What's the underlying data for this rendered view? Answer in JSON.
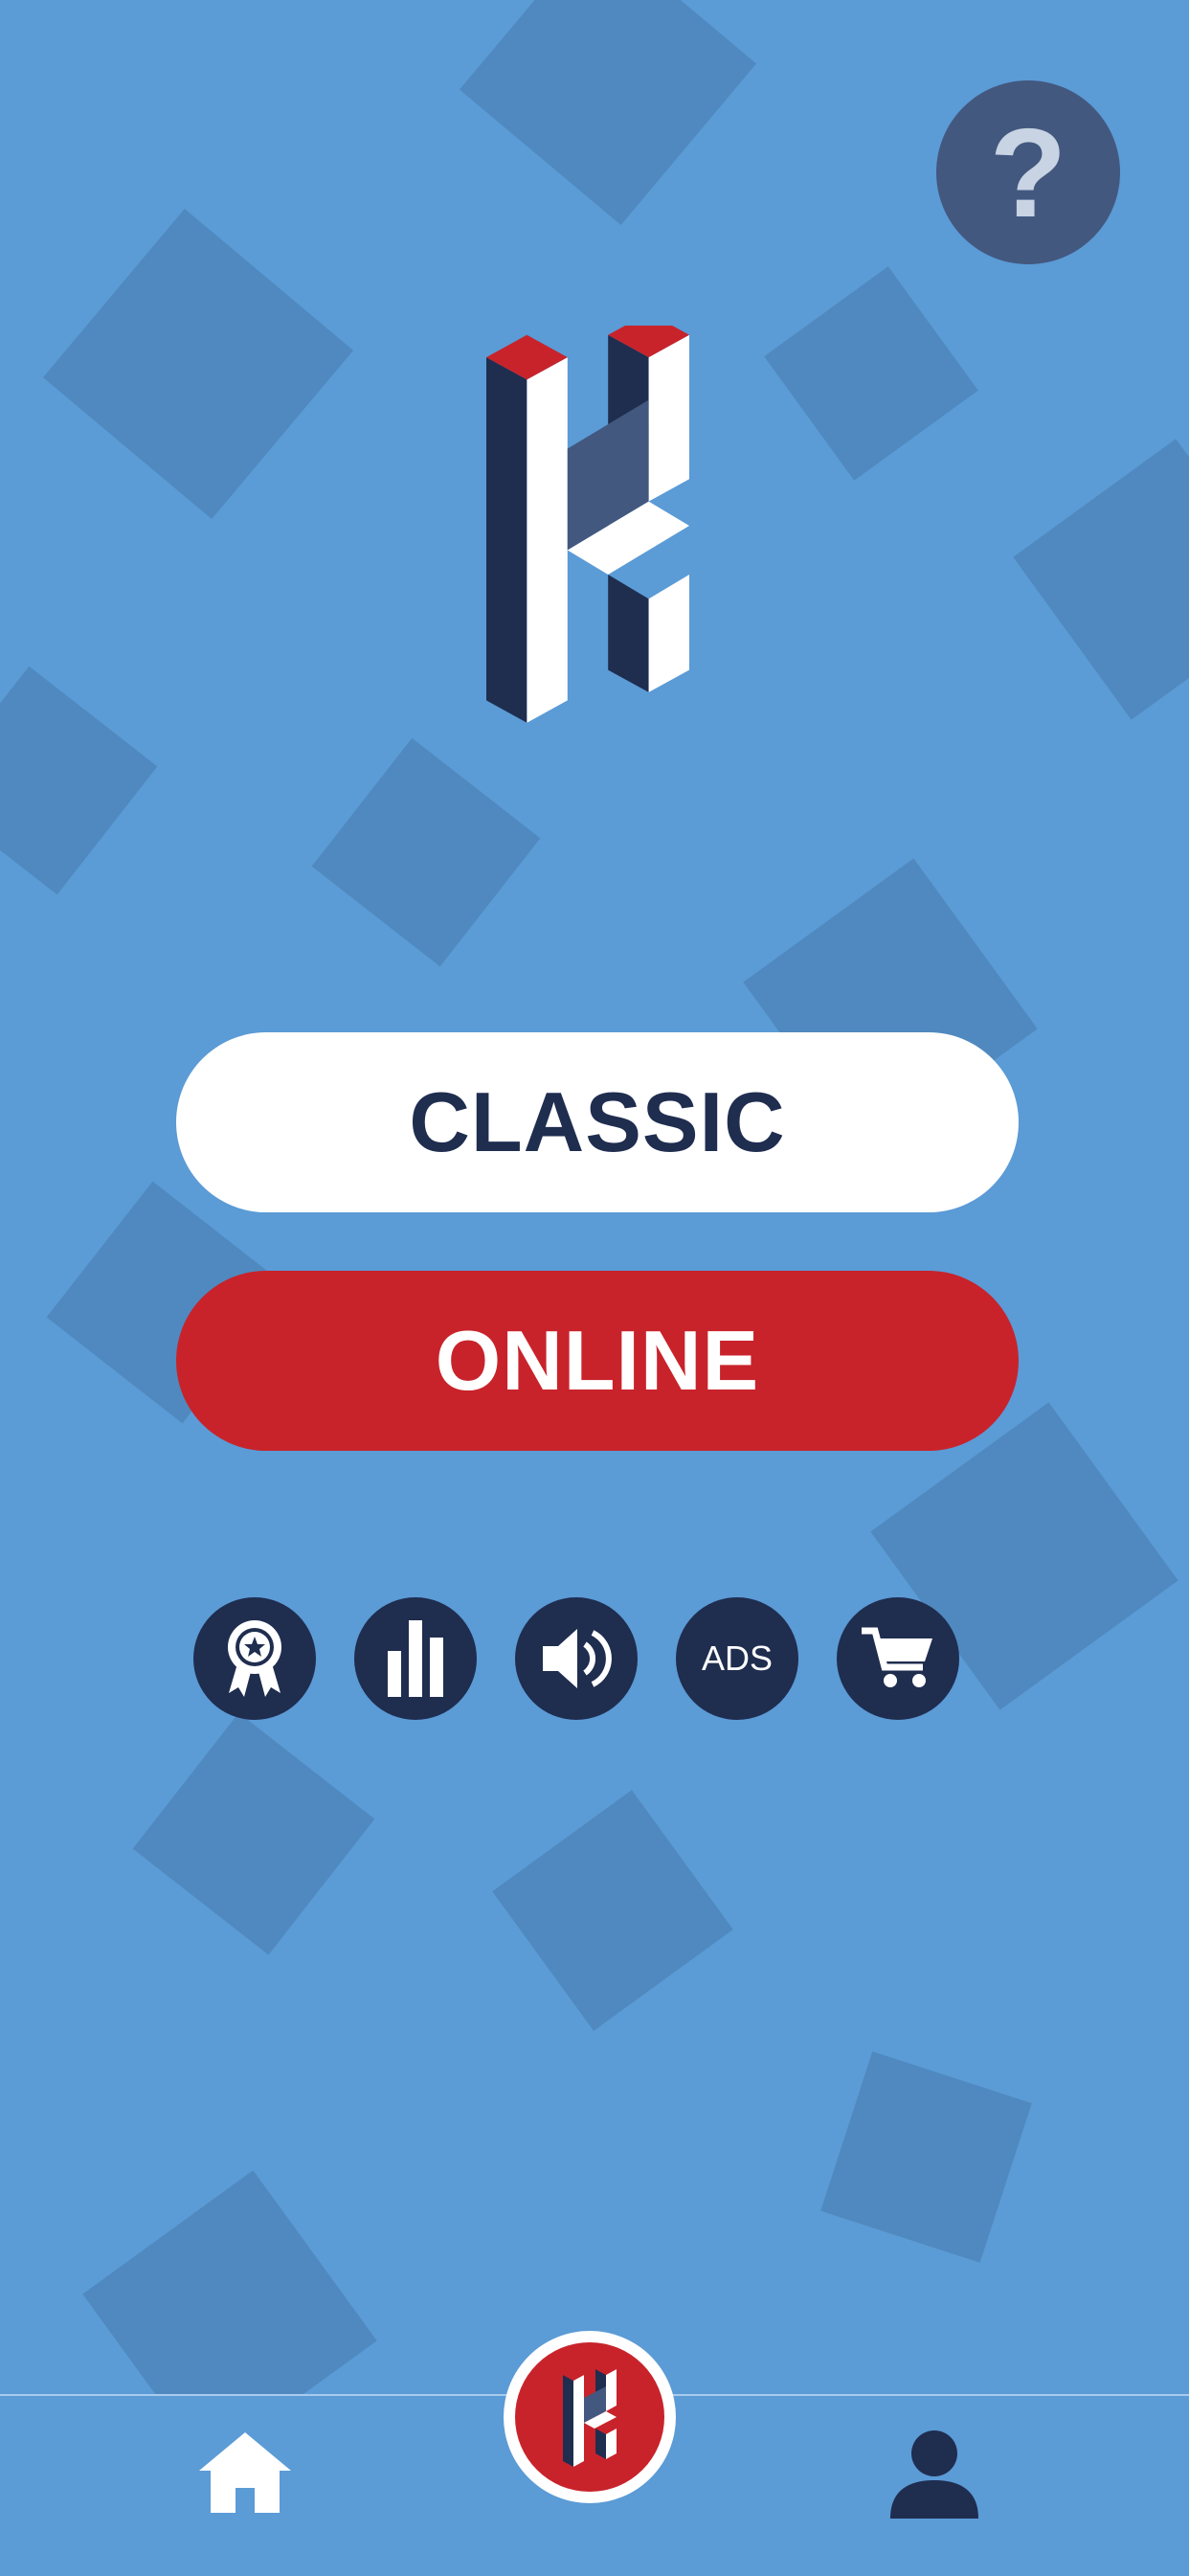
{
  "menu": {
    "classic_label": "CLASSIC",
    "online_label": "ONLINE"
  },
  "toolbar": {
    "ads_label": "ADS"
  },
  "icons": {
    "help": "question-mark-icon",
    "achievements": "award-ribbon-icon",
    "stats": "bar-chart-icon",
    "sound": "speaker-icon",
    "ads": "ads-icon",
    "shop": "cart-icon",
    "home": "home-icon",
    "game": "k-logo-icon",
    "profile": "person-icon"
  },
  "colors": {
    "background": "#5b9bd6",
    "navy": "#1f2d4f",
    "red": "#c8232b",
    "white": "#ffffff"
  }
}
